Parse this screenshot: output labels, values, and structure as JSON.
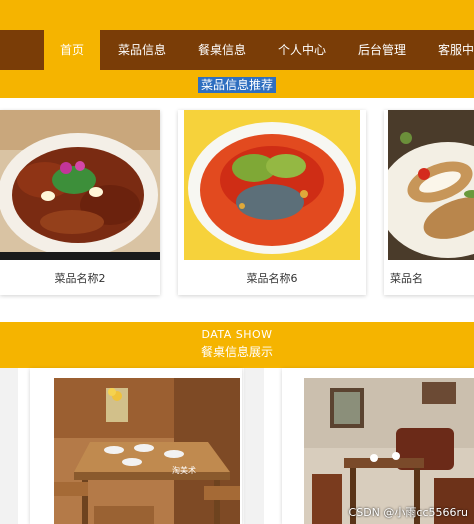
{
  "nav": {
    "items": [
      {
        "label": "首页",
        "active": true
      },
      {
        "label": "菜品信息"
      },
      {
        "label": "餐桌信息"
      },
      {
        "label": "个人中心"
      },
      {
        "label": "后台管理"
      },
      {
        "label": "客服中"
      }
    ]
  },
  "dishes_section": {
    "title": "菜品信息推荐",
    "items": [
      {
        "name": "菜品名称2"
      },
      {
        "name": "菜品名称6"
      },
      {
        "name": "菜品名"
      }
    ]
  },
  "tables_section": {
    "subtitle_en": "DATA SHOW",
    "title": "餐桌信息展示",
    "image_sign_text": "淘美术"
  },
  "watermark": "CSDN @小雨cc5566ru",
  "colors": {
    "accent_yellow": "#f5b400",
    "nav_brown": "#7a3d07",
    "selection_blue": "#2f6fc0"
  }
}
